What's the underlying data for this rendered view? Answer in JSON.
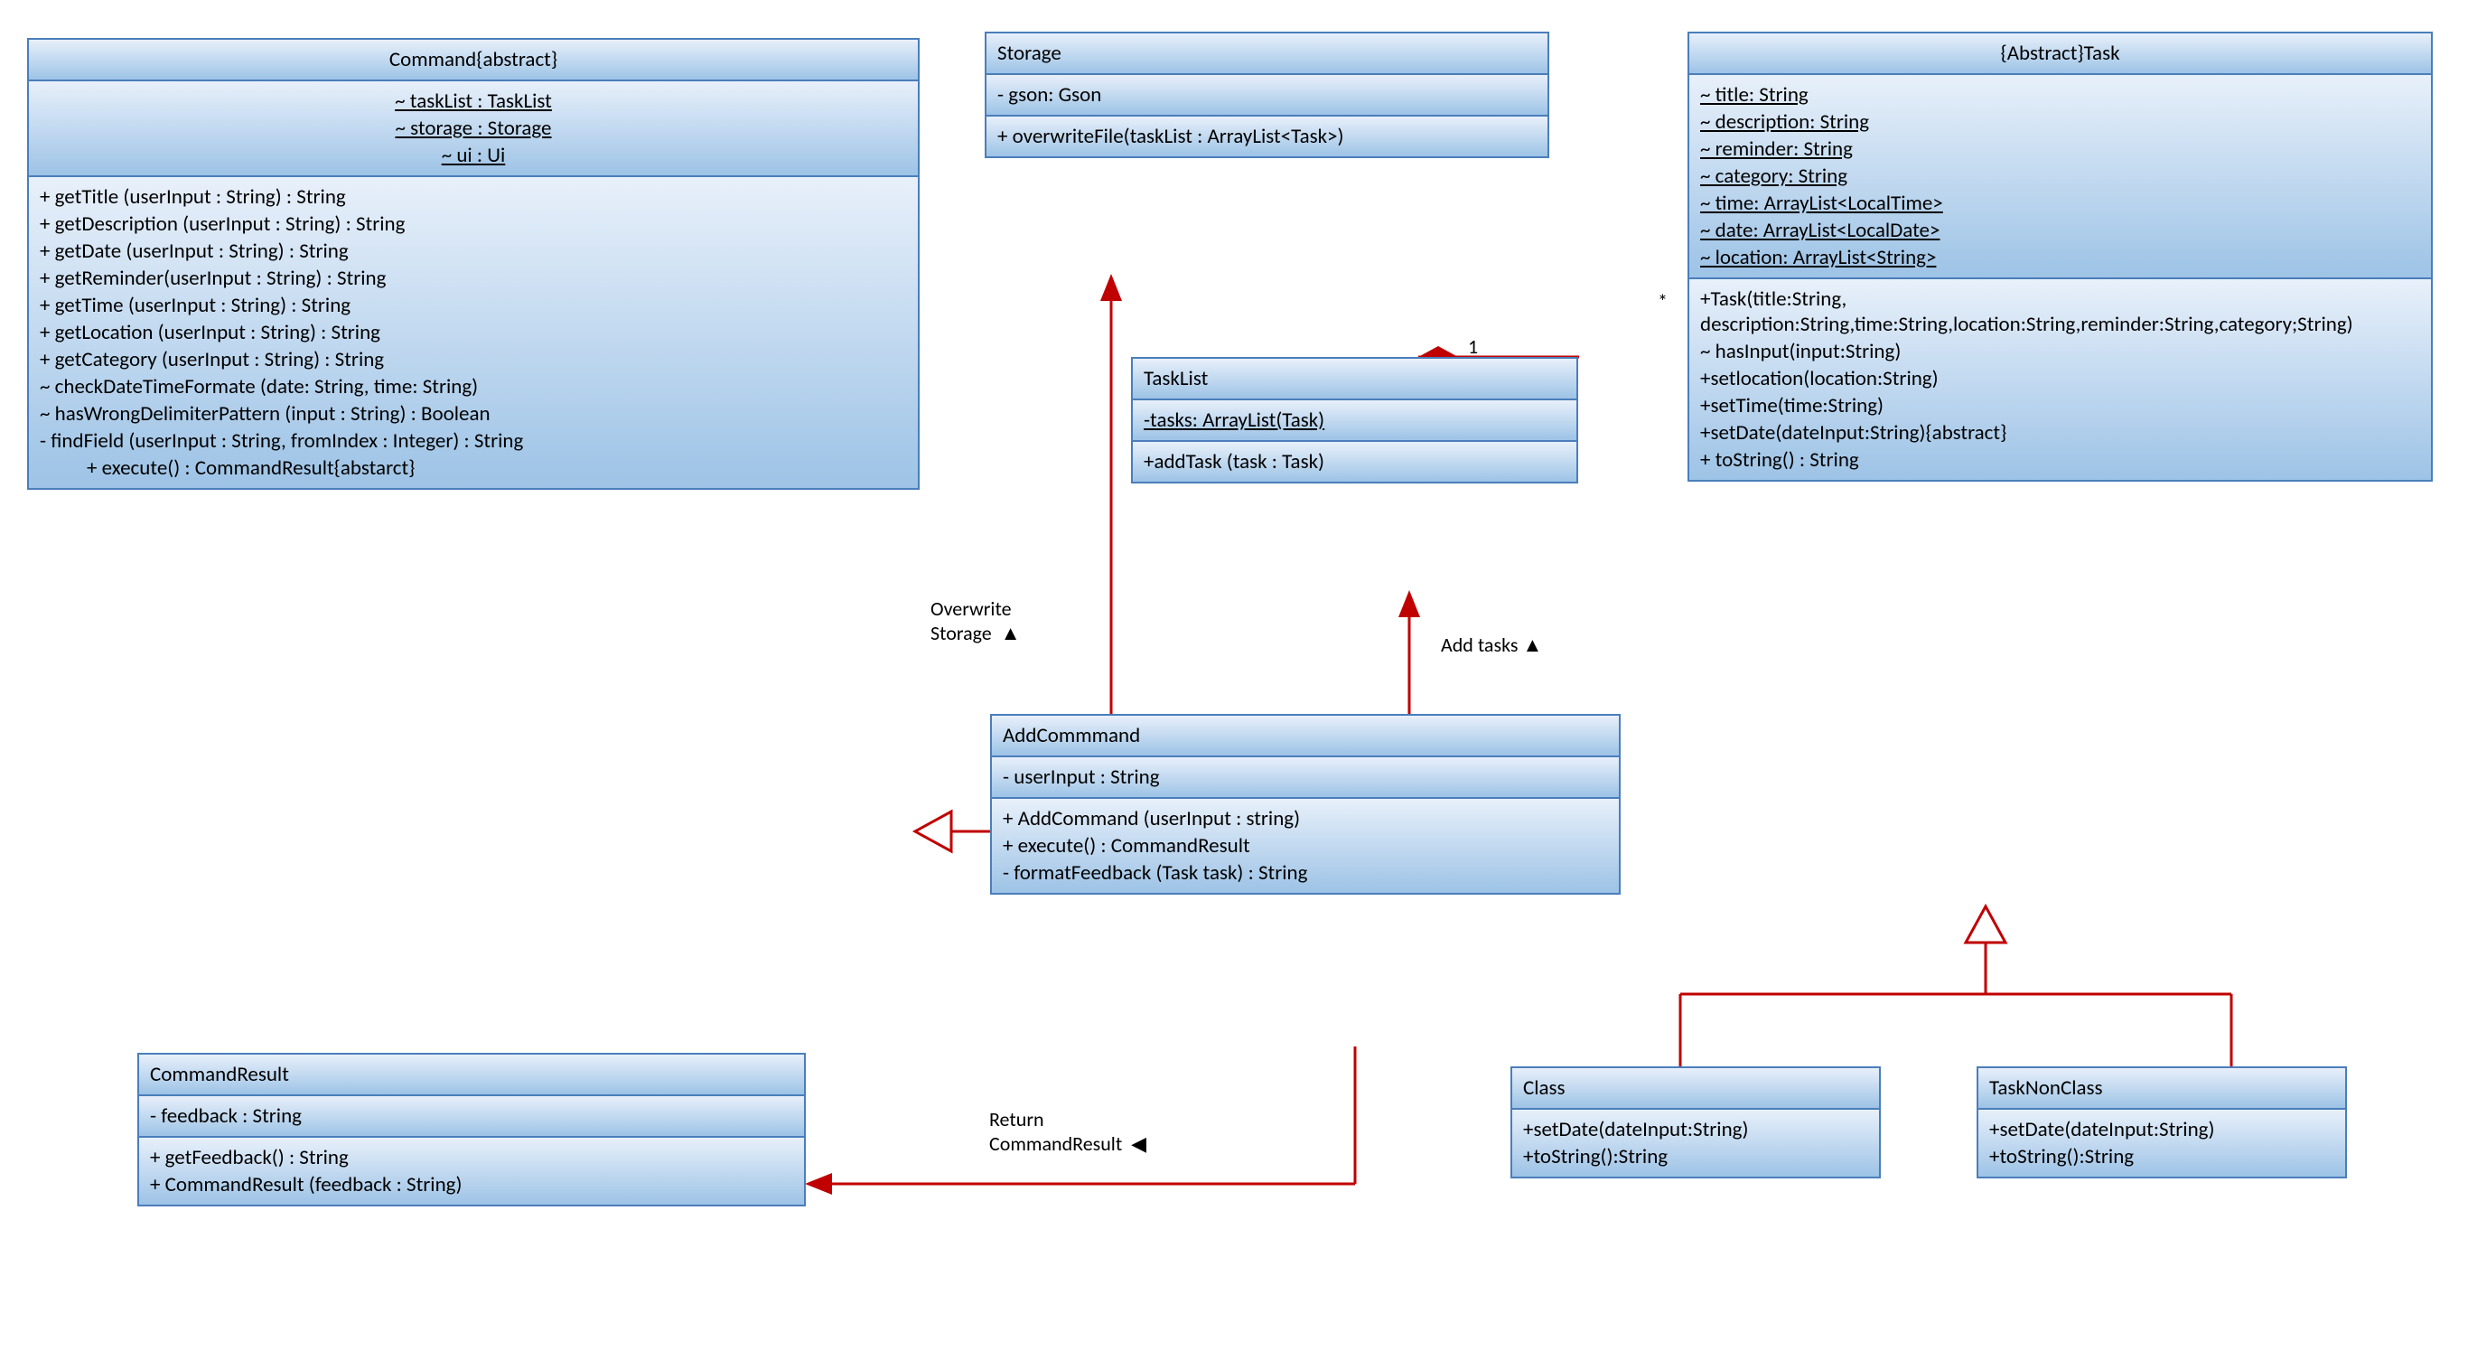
{
  "classes": {
    "command": {
      "title": "Command{abstract}",
      "attrs": [
        "~ taskList : TaskList",
        "~ storage : Storage",
        "~ ui : Ui"
      ],
      "ops": [
        "+ getTitle (userInput : String) : String",
        "+ getDescription (userInput : String) : String",
        "+ getDate (userInput : String) : String",
        "+ getReminder(userInput : String) : String",
        "+ getTime (userInput : String) : String",
        "+ getLocation (userInput : String) : String",
        "+ getCategory (userInput : String) : String",
        "~ checkDateTimeFormate (date: String, time: String)",
        "~ hasWrongDelimiterPattern (input : String) : Boolean",
        "- findField (userInput : String, fromIndex : Integer) : String",
        "          + execute() : CommandResult{abstarct}"
      ]
    },
    "storage": {
      "title": "Storage",
      "attrs": [
        "- gson: Gson"
      ],
      "ops": [
        "+ overwriteFile(taskList : ArrayList<Task>)"
      ]
    },
    "task": {
      "title": "{Abstract}Task",
      "attrs": [
        "~ title: String",
        "~ description: String",
        "~ reminder: String",
        "~ category: String",
        "~ time: ArrayList<LocalTime>",
        "~ date: ArrayList<LocalDate>",
        "~ location: ArrayList<String>"
      ],
      "ops": [
        "+Task(title:String, description:String,time:String,location:String,reminder:String,category;String)",
        "~ hasInput(input:String)",
        "+setlocation(location:String)",
        "+setTime(time:String)",
        "+setDate(dateInput:String){abstract}",
        "+ toString() : String"
      ]
    },
    "tasklist": {
      "title": "TaskList",
      "attrs": [
        "-tasks: ArrayList(Task)"
      ],
      "ops": [
        "+addTask (task : Task)"
      ]
    },
    "addcommand": {
      "title": "AddCommmand",
      "attrs": [
        "- userInput : String"
      ],
      "ops": [
        "+ AddCommand (userInput : string)",
        "+ execute() : CommandResult",
        "- formatFeedback (Task task) : String"
      ]
    },
    "commandresult": {
      "title": "CommandResult",
      "attrs": [
        "- feedback : String"
      ],
      "ops": [
        "+ getFeedback() : String",
        "+ CommandResult (feedback : String)"
      ]
    },
    "class": {
      "title": "Class",
      "ops": [
        "+setDate(dateInput:String)",
        "+toString():String"
      ]
    },
    "tasknonclass": {
      "title": "TaskNonClass",
      "ops": [
        "+setDate(dateInput:String)",
        "+toString():String"
      ]
    }
  },
  "labels": {
    "overwrite": "Overwrite\nStorage  ▲",
    "addtasks": "Add tasks  ▲",
    "return": "Return\nCommandResult  ◀",
    "one": "1",
    "star": "*"
  }
}
